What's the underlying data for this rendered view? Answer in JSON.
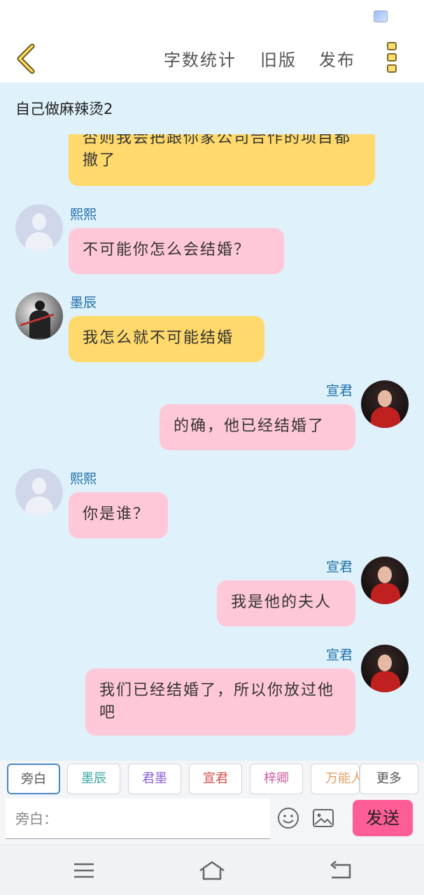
{
  "topbar": {
    "menu": [
      "字数统计",
      "旧版",
      "发布"
    ]
  },
  "chat": {
    "title": "自己做麻辣烫2",
    "messages": [
      {
        "side": "left",
        "name": "",
        "text": "否则我会把跟你家公司合作的项目都撤了",
        "color": "yellow"
      },
      {
        "side": "left",
        "name": "熙熙",
        "text": "不可能你怎么会结婚？",
        "color": "pink",
        "avatar": "default"
      },
      {
        "side": "left",
        "name": "墨辰",
        "text": "我怎么就不可能结婚",
        "color": "yellow",
        "avatar": "moc"
      },
      {
        "side": "right",
        "name": "宣君",
        "text": "的确，他已经结婚了",
        "color": "pink",
        "avatar": "xuan"
      },
      {
        "side": "left",
        "name": "熙熙",
        "text": "你是谁？",
        "color": "pink",
        "avatar": "default"
      },
      {
        "side": "right",
        "name": "宣君",
        "text": "我是他的夫人",
        "color": "pink",
        "avatar": "xuan"
      },
      {
        "side": "right",
        "name": "宣君",
        "text": "我们已经结婚了，所以你放过他吧",
        "color": "pink",
        "avatar": "xuan"
      }
    ]
  },
  "roles": [
    {
      "label": "旁白",
      "color": "#555555"
    },
    {
      "label": "墨辰",
      "color": "#3aa6a0"
    },
    {
      "label": "君墨",
      "color": "#8a5fd6"
    },
    {
      "label": "宣君",
      "color": "#d44a4a"
    },
    {
      "label": "梓卿",
      "color": "#d05aa0"
    },
    {
      "label": "万能人",
      "color": "#e0a060"
    }
  ],
  "more_label": "更多",
  "input": {
    "placeholder": "旁白："
  },
  "send_label": "发送",
  "colors": {
    "chat_bg": "#dff1fb",
    "yellow_bubble": "#ffd96b",
    "pink_bubble": "#ffc8d8",
    "send": "#ff5d96"
  }
}
